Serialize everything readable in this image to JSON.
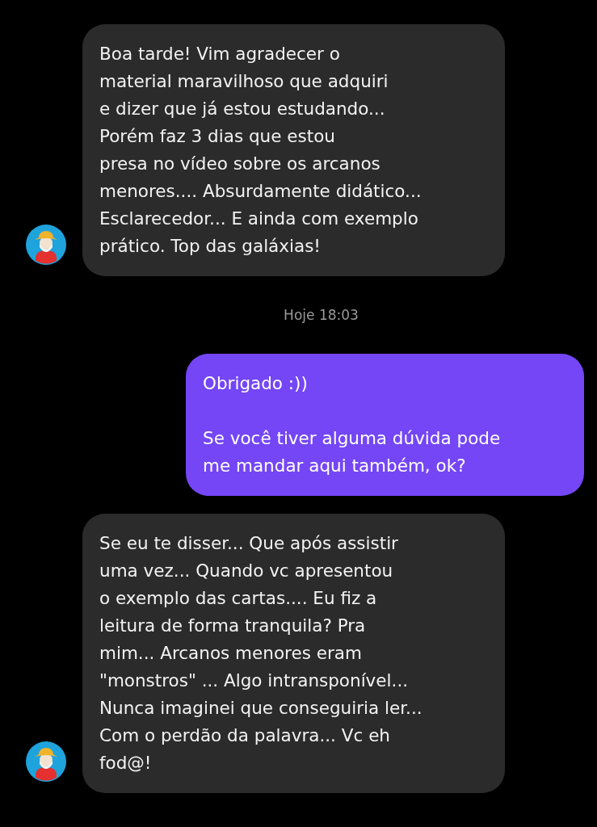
{
  "messages": [
    {
      "kind": "incoming",
      "paragraphs": [
        "Boa tarde! Vim agradecer o\nmaterial maravilhoso que adquiri\ne dizer que já estou estudando...\nPorém faz 3 dias que estou\npresa no vídeo sobre os arcanos\nmenores.... Absurdamente didático...\nEsclarecedor... E ainda com exemplo\nprático. Top das galáxias!"
      ]
    },
    {
      "kind": "timestamp",
      "text": "Hoje 18:03"
    },
    {
      "kind": "outgoing",
      "paragraphs": [
        "Obrigado :))",
        "Se você tiver alguma dúvida pode\nme mandar aqui também, ok?"
      ]
    },
    {
      "kind": "incoming",
      "paragraphs": [
        "Se eu te disser... Que após assistir\numa vez... Quando vc apresentou\no exemplo das cartas.... Eu fiz a\nleitura de forma tranquila? Pra\nmim... Arcanos menores eram\n\"monstros\" ... Algo intransponível...\nNunca imaginei que conseguiria ler...\nCom o perdão da palavra... Vc eh\nfod@!"
      ]
    }
  ]
}
